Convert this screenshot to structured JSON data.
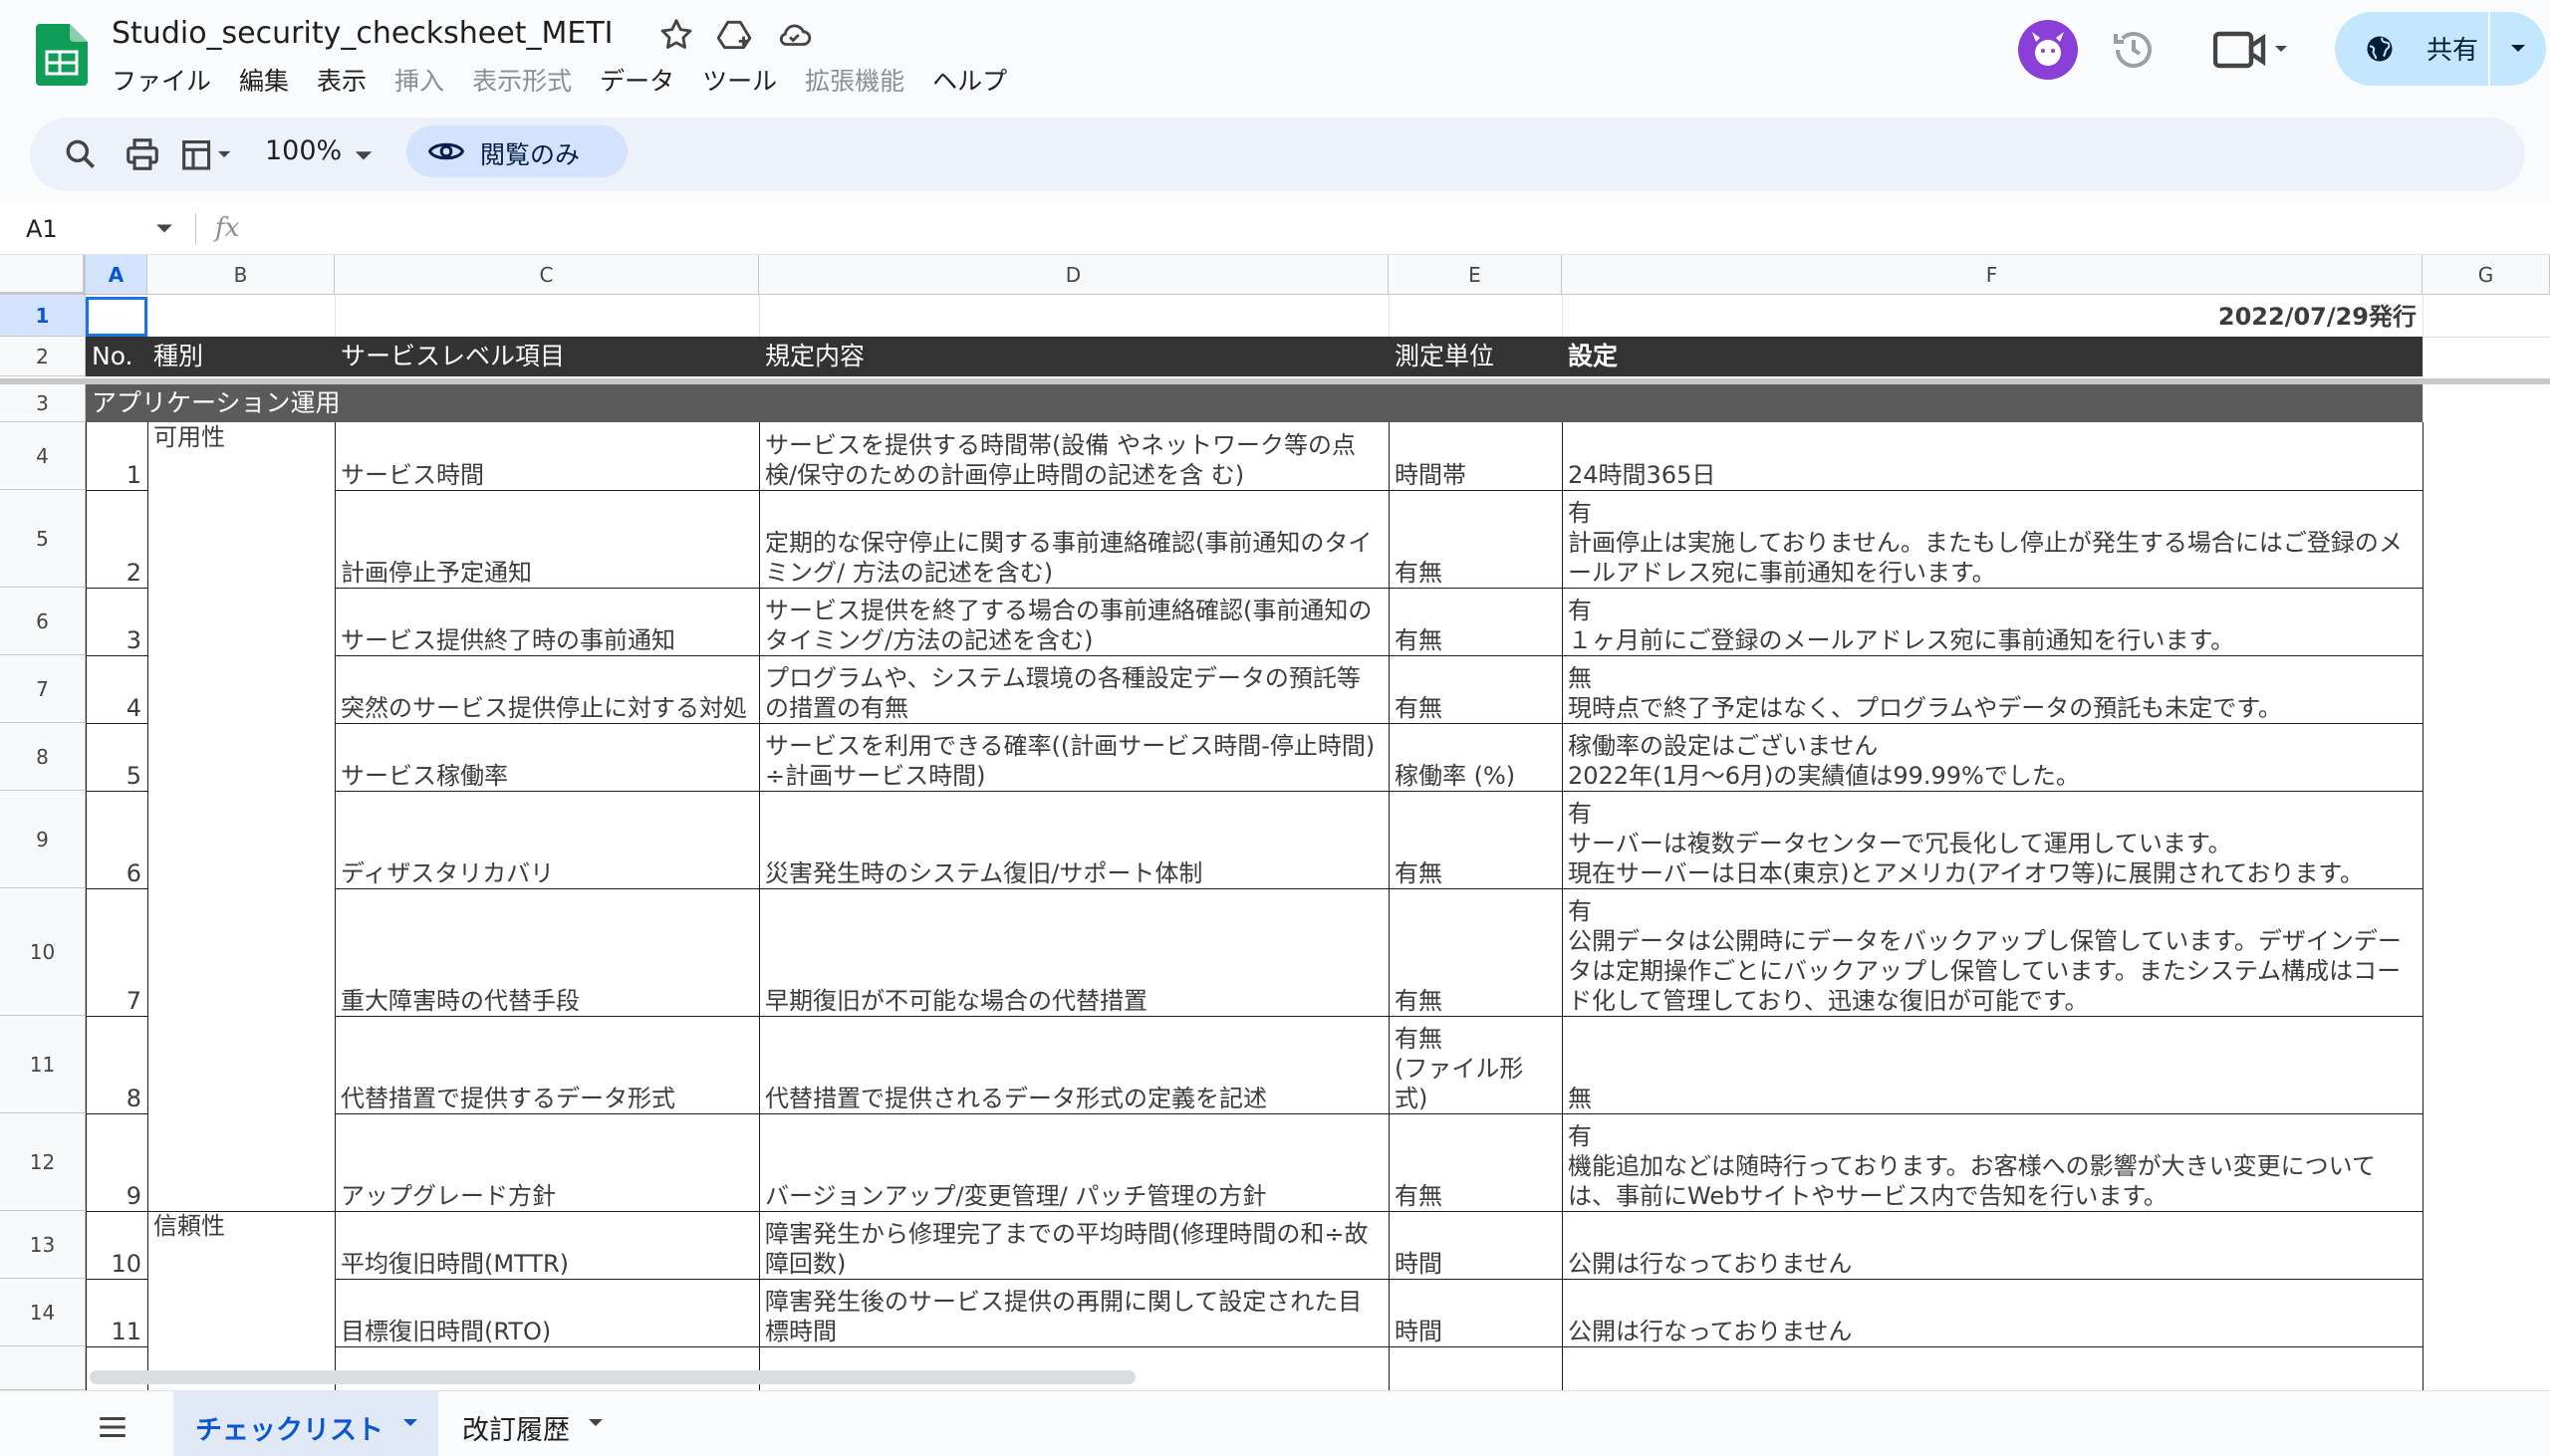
{
  "app": {
    "title": "Studio_security_checksheet_METI",
    "brand_color": "#0f9d58"
  },
  "menu": [
    {
      "label": "ファイル",
      "enabled": true
    },
    {
      "label": "編集",
      "enabled": true
    },
    {
      "label": "表示",
      "enabled": true
    },
    {
      "label": "挿入",
      "enabled": false
    },
    {
      "label": "表示形式",
      "enabled": false
    },
    {
      "label": "データ",
      "enabled": true
    },
    {
      "label": "ツール",
      "enabled": true
    },
    {
      "label": "拡張機能",
      "enabled": false
    },
    {
      "label": "ヘルプ",
      "enabled": true
    }
  ],
  "header_actions": {
    "share_label": "共有"
  },
  "toolbar": {
    "zoom": "100%",
    "view_only_label": "閲覧のみ"
  },
  "formula_bar": {
    "cell_ref": "A1",
    "fx": "fx"
  },
  "columns": [
    "A",
    "B",
    "C",
    "D",
    "E",
    "F",
    "G"
  ],
  "rows": [
    "1",
    "2",
    "3",
    "4",
    "5",
    "6",
    "7",
    "8",
    "9",
    "10",
    "11",
    "12",
    "13",
    "14"
  ],
  "sheet": {
    "issue_date": "2022/07/29発行",
    "headers": [
      "No.",
      "種別",
      "サービスレベル項目",
      "規定内容",
      "測定単位",
      "設定"
    ],
    "section": "アプリケーション運用",
    "data_rows": [
      {
        "no": "1",
        "type": "可用性",
        "item": "サービス時間",
        "desc": "サービスを提供する時間帯(設備 やネットワーク等の点検/保守のための計画停止時間の記述を含 む)",
        "unit": "時間帯",
        "setting": "24時間365日"
      },
      {
        "no": "2",
        "type": "",
        "item": "計画停止予定通知",
        "desc": "定期的な保守停止に関する事前連絡確認(事前通知のタイミング/ 方法の記述を含む)",
        "unit": "有無",
        "setting": "有\n計画停止は実施しておりません。またもし停止が発生する場合にはご登録のメールアドレス宛に事前通知を行います。"
      },
      {
        "no": "3",
        "type": "",
        "item": "サービス提供終了時の事前通知",
        "desc": "サービス提供を終了する場合の事前連絡確認(事前通知のタイミング/方法の記述を含む)",
        "unit": "有無",
        "setting": "有\n１ヶ月前にご登録のメールアドレス宛に事前通知を行います。"
      },
      {
        "no": "4",
        "type": "",
        "item": "突然のサービス提供停止に対する対処",
        "desc": "プログラムや、システム環境の各種設定データの預託等の措置の有無",
        "unit": "有無",
        "setting": "無\n現時点で終了予定はなく、プログラムやデータの預託も未定です。"
      },
      {
        "no": "5",
        "type": "",
        "item": "サービス稼働率",
        "desc": "サービスを利用できる確率((計画サービス時間-停止時間)÷計画サービス時間)",
        "unit": "稼働率 (%)",
        "setting": "稼働率の設定はございません\n2022年(1月〜6月)の実績値は99.99%でした。"
      },
      {
        "no": "6",
        "type": "",
        "item": "ディザスタリカバリ",
        "desc": "災害発生時のシステム復旧/サポート体制",
        "unit": "有無",
        "setting": "有\nサーバーは複数データセンターで冗長化して運用しています。\n現在サーバーは日本(東京)とアメリカ(アイオワ等)に展開されております。"
      },
      {
        "no": "7",
        "type": "",
        "item": "重大障害時の代替手段",
        "desc": "早期復旧が不可能な場合の代替措置",
        "unit": "有無",
        "setting": "有\n公開データは公開時にデータをバックアップし保管しています。デザインデータは定期操作ごとにバックアップし保管しています。またシステム構成はコード化して管理しており、迅速な復旧が可能です。"
      },
      {
        "no": "8",
        "type": "",
        "item": "代替措置で提供するデータ形式",
        "desc": "代替措置で提供されるデータ形式の定義を記述",
        "unit": "有無\n(ファイル形式)",
        "setting": "無"
      },
      {
        "no": "9",
        "type": "",
        "item": "アップグレード方針",
        "desc": "バージョンアップ/変更管理/ パッチ管理の方針",
        "unit": "有無",
        "setting": "有\n機能追加などは随時行っております。お客様への影響が大きい変更については、事前にWebサイトやサービス内で告知を行います。"
      },
      {
        "no": "10",
        "type": "信頼性",
        "item": "平均復旧時間(MTTR)",
        "desc": "障害発生から修理完了までの平均時間(修理時間の和÷故障回数)",
        "unit": "時間",
        "setting": "公開は行なっておりません"
      },
      {
        "no": "11",
        "type": "",
        "item": "目標復旧時間(RTO)",
        "desc": "障害発生後のサービス提供の再開に関して設定された目標時間",
        "unit": "時間",
        "setting": "公開は行なっておりません"
      }
    ]
  },
  "sheet_tabs": [
    {
      "label": "チェックリスト",
      "active": true
    },
    {
      "label": "改訂履歴",
      "active": false
    }
  ]
}
